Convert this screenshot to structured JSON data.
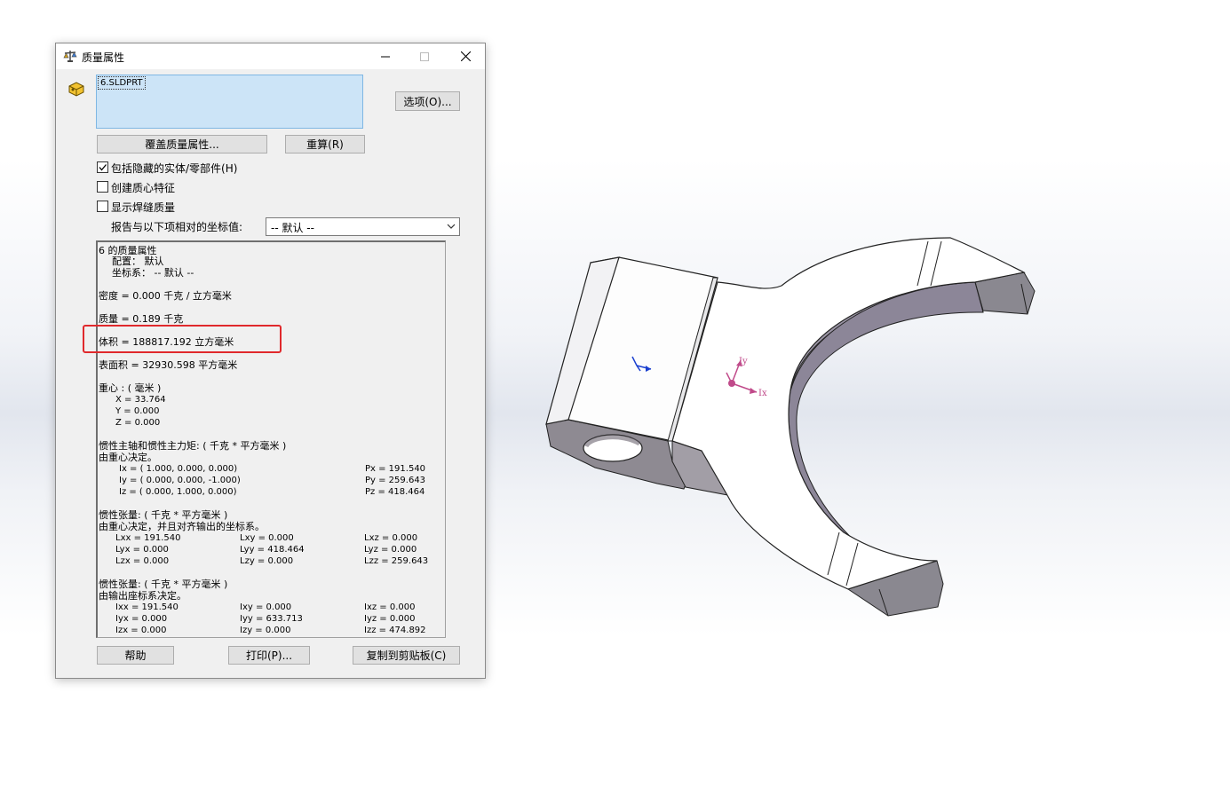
{
  "dialog": {
    "title": "质量属性",
    "list_item": "6.SLDPRT",
    "options_button": "选项(O)...",
    "override_button": "覆盖质量属性...",
    "recalc_button": "重算(R)",
    "checkbox_hidden": {
      "label": "包括隐藏的实体/零部件(H)",
      "checked": true
    },
    "checkbox_com": {
      "label": "创建质心特征",
      "checked": false
    },
    "checkbox_weld": {
      "label": "显示焊缝质量",
      "checked": false
    },
    "coord_label": "报告与以下项相对的坐标值:",
    "coord_select": "-- 默认 --",
    "help_button": "帮助",
    "print_button": "打印(P)...",
    "copy_button": "复制到剪贴板(C)"
  },
  "results": {
    "header": "6 的质量属性",
    "config": "配置：  默认",
    "coordsys": "坐标系：  -- 默认 --",
    "density": "密度 = 0.000 千克 / 立方毫米",
    "mass": "质量 = 0.189 千克",
    "volume": "体积 = 188817.192 立方毫米",
    "surface": "表面积 = 32930.598  平方毫米",
    "com_title": "重心 : ( 毫米 )",
    "com_x": "X = 33.764",
    "com_y": "Y = 0.000",
    "com_z": "Z = 0.000",
    "principal_title": "惯性主轴和惯性主力矩: ( 千克 *  平方毫米 )",
    "principal_sub": "由重心决定。",
    "ix": "Ix = ( 1.000,  0.000,  0.000)",
    "iy": "Iy = ( 0.000,  0.000, -1.000)",
    "iz": "Iz = ( 0.000,  1.000,  0.000)",
    "px": "Px = 191.540",
    "py": "Py = 259.643",
    "pz": "Pz = 418.464",
    "tensor1_title": "惯性张量: ( 千克 *  平方毫米 )",
    "tensor1_sub": "由重心决定，并且对齐输出的坐标系。",
    "t1": [
      [
        "Lxx = 191.540",
        "Lxy = 0.000",
        "Lxz = 0.000"
      ],
      [
        "Lyx = 0.000",
        "Lyy = 418.464",
        "Lyz = 0.000"
      ],
      [
        "Lzx = 0.000",
        "Lzy = 0.000",
        "Lzz = 259.643"
      ]
    ],
    "tensor2_title": "惯性张量: ( 千克 *  平方毫米 )",
    "tensor2_sub": "由输出座标系决定。",
    "t2": [
      [
        "Ixx = 191.540",
        "Ixy = 0.000",
        "Ixz = 0.000"
      ],
      [
        "Iyx = 0.000",
        "Iyy = 633.713",
        "Iyz = 0.000"
      ],
      [
        "Izx = 0.000",
        "Izy = 0.000",
        "Izz = 474.892"
      ]
    ]
  },
  "triad": {
    "ix": "Ix",
    "iy": "Iy"
  },
  "colors": {
    "highlight": "#e0292c",
    "selection": "#cce4f7",
    "triad": "#c04a8a",
    "origin": "#1a3fcf"
  },
  "icons": [
    "scale-icon",
    "minimize-icon",
    "maximize-icon",
    "close-icon",
    "part-icon",
    "chevron-down-icon",
    "checkmark-icon"
  ]
}
